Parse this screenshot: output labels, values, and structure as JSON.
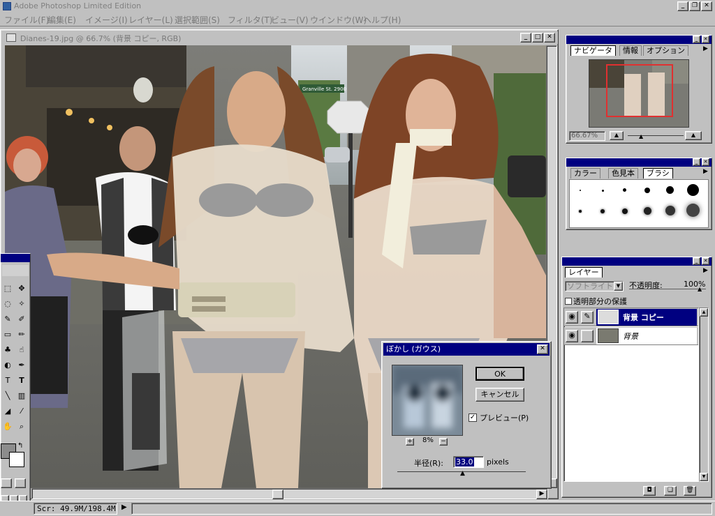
{
  "app": {
    "title": "Adobe Photoshop Limited Edition"
  },
  "menu": [
    "ファイル(F)",
    "編集(E)",
    "イメージ(I)",
    "レイヤー(L)",
    "選択範囲(S)",
    "フィルタ(T)",
    "ビュー(V)",
    "ウインドウ(W)",
    "ヘルプ(H)"
  ],
  "document": {
    "title": "Dianes-19.jpg @ 66.7% (背景 コピー, RGB)",
    "sign_text": "Granville St. 2900"
  },
  "navigator": {
    "tabs": [
      "ナビゲータ",
      "情報",
      "オプション"
    ],
    "zoom": "66.67%"
  },
  "brushes": {
    "tabs": [
      "カラー",
      "色見本",
      "ブラシ"
    ]
  },
  "layers": {
    "tab": "レイヤー",
    "blend_mode": "ソフトライト",
    "opacity_label": "不透明度:",
    "opacity_value": "100%",
    "preserve_label": "透明部分の保護",
    "items": [
      {
        "name": "背景 コピー",
        "selected": true
      },
      {
        "name": "背景",
        "selected": false
      }
    ]
  },
  "dialog": {
    "title": "ぼかし (ガウス)",
    "ok": "OK",
    "cancel": "キャンセル",
    "preview_label": "プレビュー(P)",
    "zoom": "8%",
    "radius_label": "半径(R):",
    "radius_value": "33.0",
    "unit": "pixels"
  },
  "status": {
    "scratch": "Scr: 49.9M/198.4M"
  },
  "icons": {
    "plus": "+",
    "minus": "−",
    "arrow_right": "▶",
    "arrow_left": "◀",
    "arrow_up": "▲",
    "arrow_down": "▼",
    "close": "✕",
    "checkmark": "✓"
  }
}
